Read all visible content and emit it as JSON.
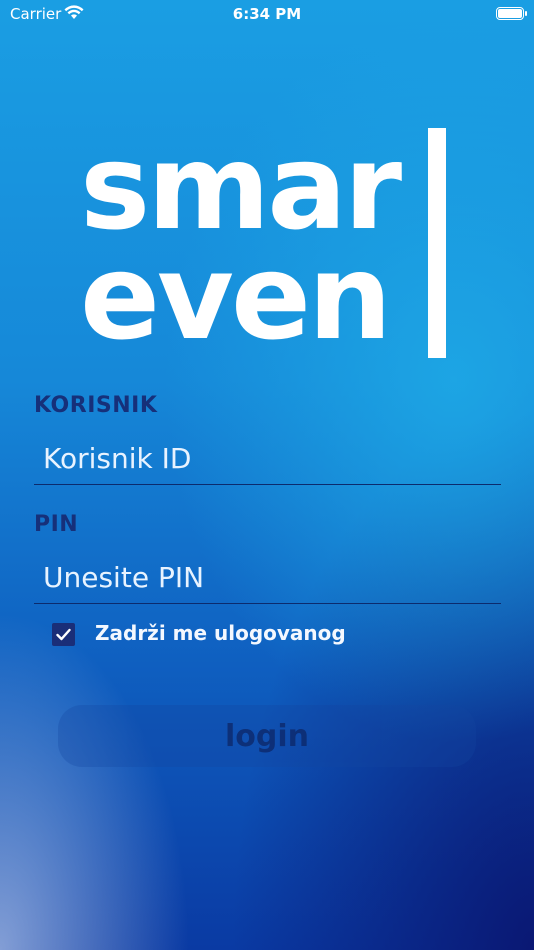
{
  "status_bar": {
    "carrier": "Carrier",
    "time": "6:34 PM"
  },
  "logo": {
    "line1": "smar",
    "line2": "even"
  },
  "form": {
    "user_label": "KORISNIK",
    "user_placeholder": "Korisnik ID",
    "pin_label": "PIN",
    "pin_placeholder": "Unesite PIN",
    "remember_label": "Zadrži me ulogovanog",
    "remember_checked": true,
    "login_label": "login"
  },
  "colors": {
    "background_top": "#1a9ee3",
    "background_bottom": "#0a3aa3",
    "label": "#16307a",
    "checkbox": "#1a2e78"
  }
}
